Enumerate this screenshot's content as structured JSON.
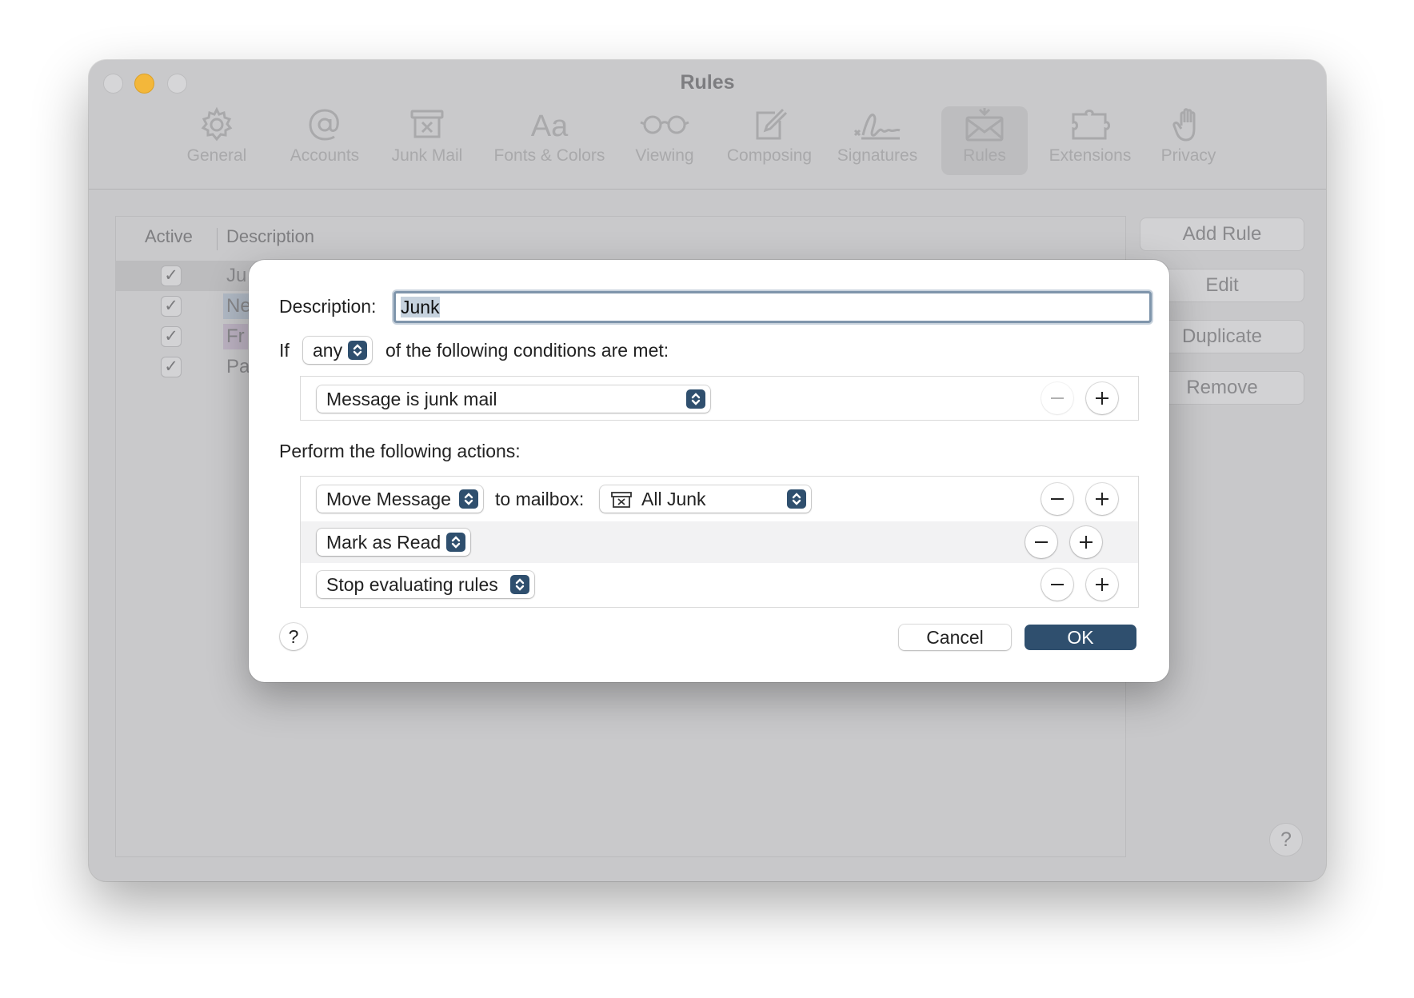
{
  "window": {
    "title": "Rules"
  },
  "toolbar": {
    "items": [
      {
        "label": "General",
        "icon": "gear-icon"
      },
      {
        "label": "Accounts",
        "icon": "at-icon"
      },
      {
        "label": "Junk Mail",
        "icon": "junk-box-icon"
      },
      {
        "label": "Fonts & Colors",
        "icon": "font-aa-icon"
      },
      {
        "label": "Viewing",
        "icon": "glasses-icon"
      },
      {
        "label": "Composing",
        "icon": "compose-icon"
      },
      {
        "label": "Signatures",
        "icon": "signature-icon"
      },
      {
        "label": "Rules",
        "icon": "envelope-rules-icon",
        "selected": true
      },
      {
        "label": "Extensions",
        "icon": "puzzle-icon"
      },
      {
        "label": "Privacy",
        "icon": "hand-icon"
      }
    ]
  },
  "table": {
    "headers": {
      "active": "Active",
      "description": "Description"
    },
    "rows": [
      {
        "checked": true,
        "label": "Ju",
        "highlight": ""
      },
      {
        "checked": true,
        "label": "Ne",
        "highlight": "#b1bac6"
      },
      {
        "checked": true,
        "label": "Fr",
        "highlight": "#bdb3c3"
      },
      {
        "checked": true,
        "label": "Pa",
        "highlight": ""
      }
    ],
    "check_glyph": "✓"
  },
  "side_buttons": {
    "add_rule": "Add Rule",
    "edit": "Edit",
    "duplicate": "Duplicate",
    "remove": "Remove",
    "help": "?"
  },
  "sheet": {
    "description_label": "Description:",
    "description_value": "Junk",
    "if_label": "If",
    "match_value": "any",
    "conditions_text": "of the following conditions are met:",
    "conditions": [
      {
        "value": "Message is junk mail"
      }
    ],
    "actions_heading": "Perform the following actions:",
    "actions": {
      "move": {
        "value": "Move Message",
        "to_label": "to mailbox:",
        "mailbox": "All Junk",
        "mailbox_icon": "junk-box-icon"
      },
      "mark": {
        "value": "Mark as Read"
      },
      "stop": {
        "value": "Stop evaluating rules"
      }
    },
    "help": "?",
    "cancel": "Cancel",
    "ok": "OK"
  },
  "colors": {
    "accent": "#2f4f6e",
    "traffic_minimize": "#f3b73a",
    "focus_ring": "#7f95ab"
  }
}
